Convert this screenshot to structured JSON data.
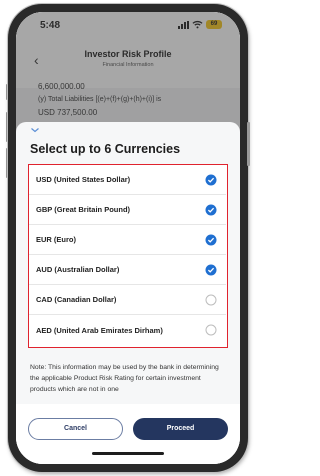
{
  "status_bar": {
    "time": "5:48",
    "battery": "69",
    "battery_color": "#f5c518"
  },
  "background_page": {
    "back_icon": "chevron-left-icon",
    "title": "Investor Risk Profile",
    "subtitle": "Financial Information",
    "lines": [
      "6,600,000.00",
      "(y) Total Liabilities [(e)+(f)+(g)+(h)+(i)] is",
      "USD 737,500.00"
    ]
  },
  "sheet": {
    "collapse_icon": "chevron-down-icon",
    "title": "Select up to 6 Currencies",
    "currencies": [
      {
        "label": "USD (United States Dollar)",
        "selected": true
      },
      {
        "label": "GBP (Great Britain Pound)",
        "selected": true
      },
      {
        "label": "EUR (Euro)",
        "selected": true
      },
      {
        "label": "AUD (Australian Dollar)",
        "selected": true
      },
      {
        "label": "CAD (Canadian Dollar)",
        "selected": false
      },
      {
        "label": "AED (United Arab Emirates Dirham)",
        "selected": false
      }
    ],
    "note": "Note: This information may be used by the bank in determining the applicable Product Risk Rating for certain investment products which are not in one",
    "cancel_label": "Cancel",
    "proceed_label": "Proceed"
  },
  "colors": {
    "highlight_border": "#e0232e",
    "check_selected": "#1f6fd1",
    "check_unselected": "#bdbdbd",
    "primary_button": "#24365f"
  }
}
